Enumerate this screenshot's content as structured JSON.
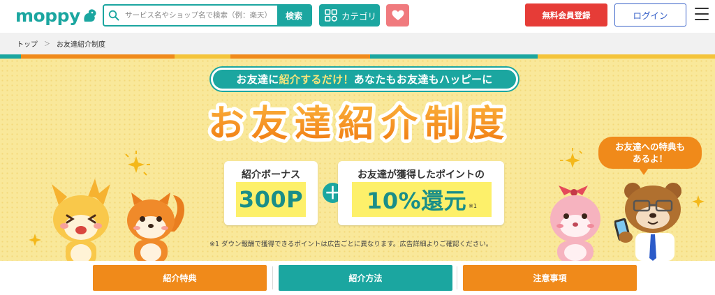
{
  "header": {
    "logo_text": "moppy",
    "search": {
      "placeholder": "サービス名やショップ名で検索（例：楽天）",
      "value": "",
      "button_label": "検索"
    },
    "category_label": "カテゴリ",
    "favorite_icon": "heart-icon",
    "register_label": "無料会員登録",
    "login_label": "ログイン",
    "menu_icon": "hamburger-icon"
  },
  "breadcrumb": {
    "items": [
      "トップ",
      "お友達紹介制度"
    ],
    "separator": "＞"
  },
  "hero": {
    "tagline_parts": [
      "お友達に",
      "紹介するだけ！",
      "あなたもお友達もハッピーに"
    ],
    "title": "お友達紹介制度",
    "bonus": {
      "label": "紹介ボーナス",
      "value": "300P"
    },
    "plus": "＋",
    "friend_bonus": {
      "label": "お友達が獲得したポイントの",
      "value": "10%還元",
      "note_mark": "※1"
    },
    "footnote": "※1 ダウン報酬で獲得できるポイントは広告ごとに異なります。広告詳細よりご確認ください。",
    "speech": [
      "お友達への特典も",
      "あるよ！"
    ],
    "characters": [
      "dragon-character",
      "squirrel-character",
      "pink-squirrel-character",
      "bear-with-phone-character"
    ]
  },
  "anchor_nav": {
    "items": [
      {
        "label": "紹介特典",
        "color": "#f08a1a"
      },
      {
        "label": "紹介方法",
        "color": "#1ba6a0"
      },
      {
        "label": "注意事項",
        "color": "#f08a1a"
      }
    ]
  },
  "colors": {
    "brand_teal": "#1ba6a0",
    "accent_orange": "#f08a1a",
    "register_red": "#e63c37",
    "login_blue": "#3a63c9",
    "hero_yellow": "#f9e89a"
  }
}
